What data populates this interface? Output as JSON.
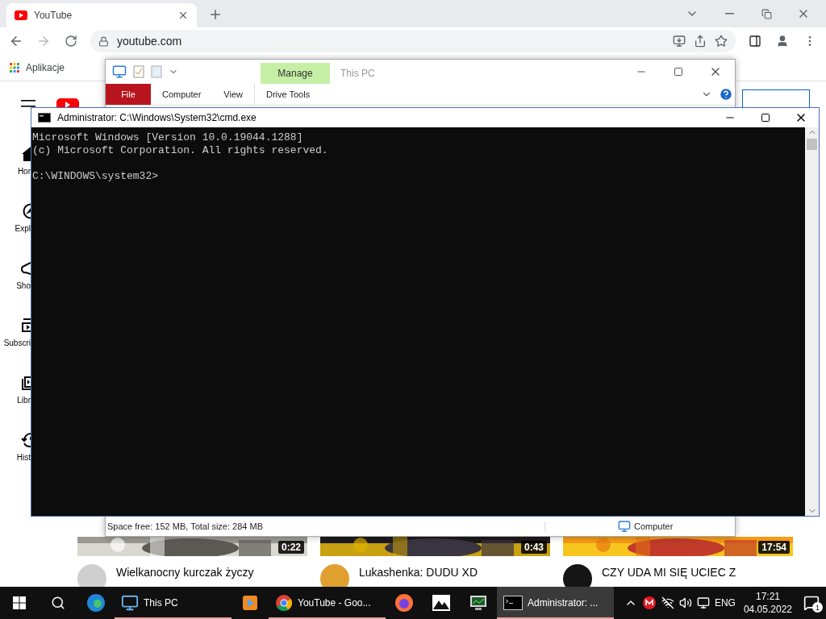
{
  "browser": {
    "tab_title": "YouTube",
    "url": "youtube.com",
    "bookmarks": [
      "Aplikacje"
    ]
  },
  "youtube": {
    "sidebar": [
      "Hor",
      "Expl",
      "Sho",
      "Subscri",
      "Libr",
      "Hist"
    ],
    "videos": [
      {
        "duration": "0:22",
        "title": "Wielkanocny kurczak życzy"
      },
      {
        "duration": "0:43",
        "title": "Lukashenka: DUDU XD"
      },
      {
        "duration": "17:54",
        "title": "CZY UDA MI SIĘ UCIEC Z"
      }
    ]
  },
  "explorer": {
    "title": "This PC",
    "context_tab": "Manage",
    "ribbon_tabs": [
      {
        "label": "File",
        "kind": "file"
      },
      {
        "label": "Computer",
        "kind": "tab"
      },
      {
        "label": "View",
        "kind": "tab"
      },
      {
        "label": "Drive Tools",
        "kind": "context"
      }
    ],
    "status": "Space free: 152 MB, Total size: 284 MB",
    "status_location": "Computer"
  },
  "cmd": {
    "title": "Administrator: C:\\Windows\\System32\\cmd.exe",
    "lines": [
      "Microsoft Windows [Version 10.0.19044.1288]",
      "(c) Microsoft Corporation. All rights reserved."
    ],
    "prompt": "C:\\WINDOWS\\system32>"
  },
  "taskbar": {
    "apps": [
      {
        "kind": "edge",
        "running": false,
        "selected": false
      },
      {
        "kind": "explorer",
        "label": "This PC",
        "running": true,
        "selected": false
      },
      {
        "kind": "media",
        "running": false,
        "selected": false
      },
      {
        "kind": "chrome",
        "label": "YouTube - Goo...",
        "running": true,
        "selected": false
      },
      {
        "kind": "firefox",
        "running": false,
        "selected": false
      },
      {
        "kind": "photos",
        "running": false,
        "selected": false
      },
      {
        "kind": "monitor",
        "running": false,
        "selected": false
      },
      {
        "kind": "cmd",
        "label": "Administrator: ...",
        "running": true,
        "selected": true
      }
    ],
    "language": "ENG",
    "time": "17:21",
    "date": "04.05.2022",
    "notifications": "1"
  }
}
